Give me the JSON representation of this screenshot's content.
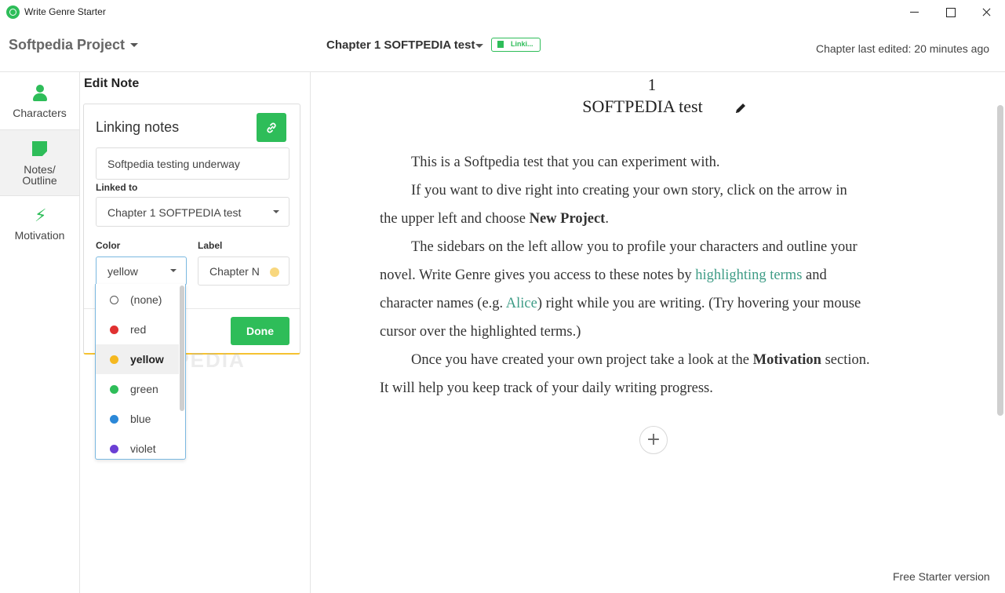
{
  "window": {
    "title": "Write Genre Starter"
  },
  "header": {
    "project_title": "Softpedia Project",
    "chapter_title": "Chapter 1 SOFTPEDIA test",
    "linking_badge": "Linki...",
    "last_edited": "Chapter last edited: 20 minutes ago"
  },
  "sidebar": {
    "items": [
      {
        "label": "Characters",
        "icon": "person-icon"
      },
      {
        "label_line1": "Notes/",
        "label_line2": "Outline",
        "icon": "note-icon"
      },
      {
        "label": "Motivation",
        "icon": "bolt-icon"
      }
    ]
  },
  "edit_note": {
    "title": "Edit Note",
    "card_title": "Linking notes",
    "title_value": "Softpedia testing underway",
    "linked_to_label": "Linked to",
    "linked_to_value": "Chapter 1 SOFTPEDIA test",
    "color_label": "Color",
    "color_value": "yellow",
    "label_label": "Label",
    "label_value": "Chapter N",
    "label_color": "#f8d77e",
    "done_label": "Done",
    "color_options": [
      {
        "name": "(none)",
        "color": ""
      },
      {
        "name": "red",
        "color": "#e03131"
      },
      {
        "name": "yellow",
        "color": "#f5b820"
      },
      {
        "name": "green",
        "color": "#2ebd59"
      },
      {
        "name": "blue",
        "color": "#2b88d8"
      },
      {
        "name": "violet",
        "color": "#6b3fd4"
      }
    ]
  },
  "editor": {
    "chapter_number": "1",
    "chapter_heading": "SOFTPEDIA test",
    "p1": "This is a Softpedia test that you can experiment with.",
    "p2_a": "If you want to dive right into creating your own story, click on the arrow in",
    "p2_b": "the upper left and choose ",
    "p2_bold": "New Project",
    "p2_c": ".",
    "p3_a": "The sidebars on the left allow you to profile your characters and outline your",
    "p3_b": "novel. Write Genre gives you access to these notes by ",
    "p3_link": "highlighting terms",
    "p3_c": " and",
    "p3_d": "character names (e.g. ",
    "p3_link2": "Alice",
    "p3_e": ") right while you are writing. (Try hovering your mouse",
    "p3_f": "cursor over the highlighted terms.)",
    "p4_a": "Once you have created your own project take a look at the ",
    "p4_bold": "Motivation",
    "p4_b": " section.",
    "p4_c": "It will help you keep track of your daily writing progress.",
    "add_label": "+",
    "version": "Free Starter version"
  },
  "colors": {
    "accent": "#2ebd59",
    "highlight_text": "#3e9c86"
  },
  "watermark": "SOFTPEDIA"
}
